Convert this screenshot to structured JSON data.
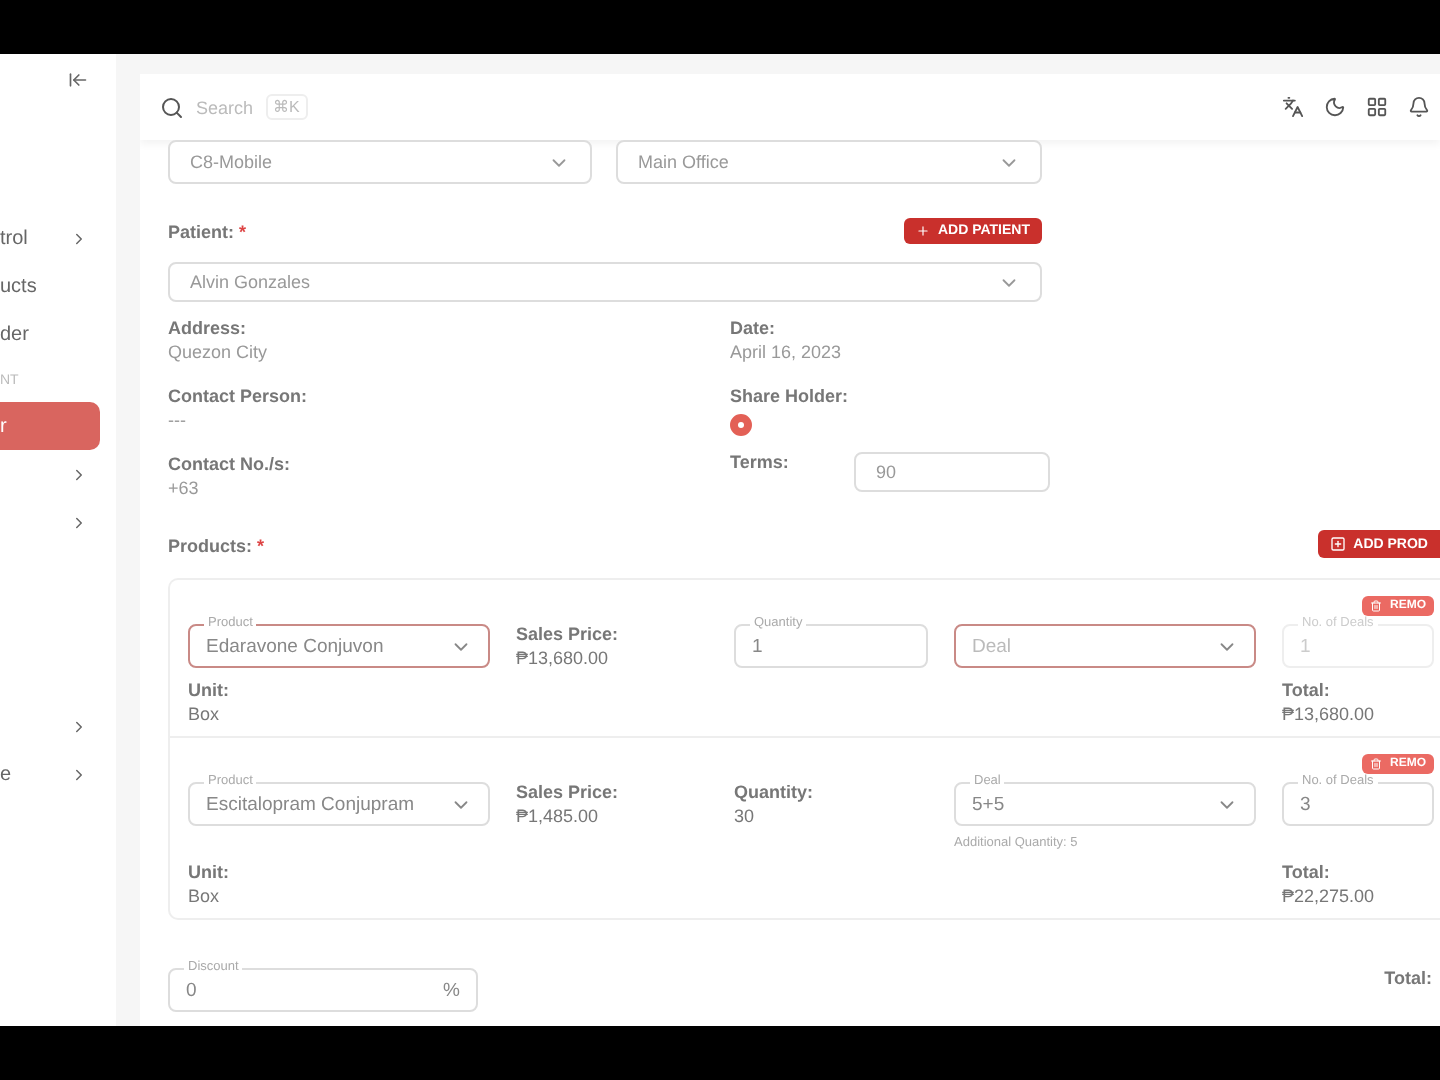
{
  "sidebar": {
    "items": [
      {
        "kind": "group",
        "label": "trol",
        "selected": false
      },
      {
        "kind": "link",
        "label": "ucts",
        "selected": false
      },
      {
        "kind": "link",
        "label": "der",
        "selected": false
      },
      {
        "kind": "section",
        "label": "NT"
      },
      {
        "kind": "link",
        "label": "r",
        "selected": true
      },
      {
        "kind": "group",
        "selected": false
      },
      {
        "kind": "group",
        "selected": false
      },
      {
        "kind": "spacer"
      },
      {
        "kind": "group",
        "selected": false
      },
      {
        "kind": "group",
        "label": "e",
        "selected": false
      }
    ]
  },
  "header": {
    "search": {
      "placeholder": "Search",
      "shortcut": "⌘K"
    }
  },
  "branch_fields": [
    {
      "value": "C8-Mobile"
    },
    {
      "value": "Main Office"
    }
  ],
  "patient": {
    "label": "Patient:",
    "required_mark": "*",
    "add_button": "ADD PATIENT",
    "value": "Alvin Gonzales"
  },
  "details_left": [
    {
      "label": "Address:",
      "value": "Quezon City"
    },
    {
      "label": "Contact Person:",
      "value": "---"
    },
    {
      "label": "Contact No./s:",
      "value": "+63"
    }
  ],
  "date": {
    "label": "Date:",
    "value": "April 16, 2023"
  },
  "share_holder": {
    "label": "Share Holder:",
    "checked": true
  },
  "terms": {
    "label": "Terms:",
    "value": "90"
  },
  "products": {
    "label": "Products:",
    "required_mark": "*",
    "add_button": "ADD PROD",
    "items": [
      {
        "product_label": "Product",
        "product": "Edaravone Conjuvon",
        "focused": true,
        "sales_price_label": "Sales Price:",
        "sales_price": "₱13,680.00",
        "quantity": {
          "kind": "field",
          "label": "Quantity",
          "value": "1"
        },
        "deal": {
          "placeholder": "Deal",
          "focused": true
        },
        "deals": {
          "label": "No. of Deals",
          "value": "1",
          "disabled": true
        },
        "remove": "REMO",
        "unit_label": "Unit:",
        "unit": "Box",
        "total_label": "Total:",
        "total": "₱13,680.00"
      },
      {
        "product_label": "Product",
        "product": "Escitalopram Conjupram",
        "focused": false,
        "sales_price_label": "Sales Price:",
        "sales_price": "₱1,485.00",
        "quantity": {
          "kind": "text",
          "label": "Quantity:",
          "value": "30"
        },
        "deal": {
          "label": "Deal",
          "value": "5+5",
          "note": "Additional Quantity: 5",
          "focused": false
        },
        "deals": {
          "label": "No. of Deals",
          "value": "3",
          "disabled": false
        },
        "remove": "REMO",
        "unit_label": "Unit:",
        "unit": "Box",
        "total_label": "Total:",
        "total": "₱22,275.00"
      }
    ]
  },
  "discount": {
    "label": "Discount",
    "value": "0",
    "suffix": "%"
  },
  "grand_total": {
    "label": "Total:"
  }
}
